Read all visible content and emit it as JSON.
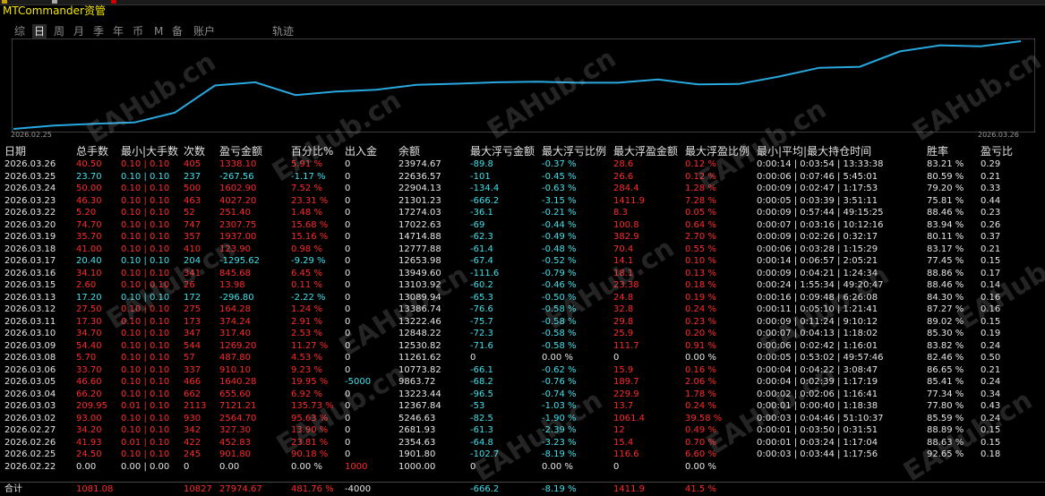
{
  "title": "MTCommander资管",
  "tabs": [
    "综",
    "日",
    "周",
    "月",
    "季",
    "年",
    "币",
    "M",
    "备",
    "账户",
    "轨迹"
  ],
  "active_tab": "日",
  "chart": {
    "start_date": "2026.02.25",
    "end_date": "2026.03.26",
    "line_color": "#29a8e0"
  },
  "headers": [
    "日期",
    "总手数",
    "最小|大手数",
    "次数",
    "盈亏金额",
    "百分比%",
    "出入金",
    "余额",
    "最大浮亏金额",
    "最大浮亏比例",
    "最大浮盈金额",
    "最大浮盈比例",
    "最小|平均|最大持仓时间",
    "胜率",
    "盈亏比"
  ],
  "rows": [
    {
      "d": "2026.03.26",
      "lots": "40.50",
      "mm": "0.10 | 0.10",
      "n": "405",
      "pl": "1338.10",
      "pct": "5.91 %",
      "io": "0",
      "bal": "23974.67",
      "fl": "-89.8",
      "flp": "-0.37 %",
      "fp": "28.6",
      "fpp": "0.12 %",
      "t": "0:00:14 | 0:03:54 | 13:33:38",
      "wr": "83.21 %",
      "rr": "0.29",
      "s": "r"
    },
    {
      "d": "2026.03.25",
      "lots": "23.70",
      "mm": "0.10 | 0.10",
      "n": "237",
      "pl": "-267.56",
      "pct": "-1.17 %",
      "io": "0",
      "bal": "22636.57",
      "fl": "-101",
      "flp": "-0.45 %",
      "fp": "26.6",
      "fpp": "0.12 %",
      "t": "0:00:06 | 0:07:46 | 5:45:01",
      "wr": "80.59 %",
      "rr": "0.21",
      "s": "c"
    },
    {
      "d": "2026.03.24",
      "lots": "50.00",
      "mm": "0.10 | 0.10",
      "n": "500",
      "pl": "1602.90",
      "pct": "7.52 %",
      "io": "0",
      "bal": "22904.13",
      "fl": "-134.4",
      "flp": "-0.63 %",
      "fp": "284.4",
      "fpp": "1.28 %",
      "t": "0:00:09 | 0:02:47 | 1:17:53",
      "wr": "79.20 %",
      "rr": "0.33",
      "s": "r"
    },
    {
      "d": "2026.03.23",
      "lots": "46.30",
      "mm": "0.10 | 0.10",
      "n": "463",
      "pl": "4027.20",
      "pct": "23.31 %",
      "io": "0",
      "bal": "21301.23",
      "fl": "-666.2",
      "flp": "-3.15 %",
      "fp": "1411.9",
      "fpp": "7.28 %",
      "t": "0:00:05 | 0:03:39 | 3:51:11",
      "wr": "75.81 %",
      "rr": "0.44",
      "s": "r"
    },
    {
      "d": "2026.03.22",
      "lots": "5.20",
      "mm": "0.10 | 0.10",
      "n": "52",
      "pl": "251.40",
      "pct": "1.48 %",
      "io": "0",
      "bal": "17274.03",
      "fl": "-36.1",
      "flp": "-0.21 %",
      "fp": "8.3",
      "fpp": "0.05 %",
      "t": "0:00:09 | 0:57:44 | 49:15:25",
      "wr": "88.46 %",
      "rr": "0.23",
      "s": "r"
    },
    {
      "d": "2026.03.20",
      "lots": "74.70",
      "mm": "0.10 | 0.10",
      "n": "747",
      "pl": "2307.75",
      "pct": "15.68 %",
      "io": "0",
      "bal": "17022.63",
      "fl": "-69",
      "flp": "-0.44 %",
      "fp": "100.8",
      "fpp": "0.64 %",
      "t": "0:00:07 | 0:03:16 | 10:12:16",
      "wr": "83.94 %",
      "rr": "0.26",
      "s": "r"
    },
    {
      "d": "2026.03.19",
      "lots": "35.70",
      "mm": "0.10 | 0.10",
      "n": "357",
      "pl": "1937.00",
      "pct": "15.16 %",
      "io": "0",
      "bal": "14714.88",
      "fl": "-62.3",
      "flp": "-0.49 %",
      "fp": "382.9",
      "fpp": "2.70 %",
      "t": "0:00:09 | 0:02:26 | 0:32:17",
      "wr": "80.11 %",
      "rr": "0.37",
      "s": "r"
    },
    {
      "d": "2026.03.18",
      "lots": "41.00",
      "mm": "0.10 | 0.10",
      "n": "410",
      "pl": "123.90",
      "pct": "0.98 %",
      "io": "0",
      "bal": "12777.88",
      "fl": "-61.4",
      "flp": "-0.48 %",
      "fp": "70.4",
      "fpp": "0.55 %",
      "t": "0:00:06 | 0:03:28 | 1:15:29",
      "wr": "83.17 %",
      "rr": "0.21",
      "s": "r"
    },
    {
      "d": "2026.03.17",
      "lots": "20.40",
      "mm": "0.10 | 0.10",
      "n": "204",
      "pl": "-1295.62",
      "pct": "-9.29 %",
      "io": "0",
      "bal": "12653.98",
      "fl": "-67.4",
      "flp": "-0.52 %",
      "fp": "14.1",
      "fpp": "0.10 %",
      "t": "0:00:14 | 0:06:57 | 2:05:21",
      "wr": "77.45 %",
      "rr": "0.15",
      "s": "c"
    },
    {
      "d": "2026.03.16",
      "lots": "34.10",
      "mm": "0.10 | 0.10",
      "n": "341",
      "pl": "845.68",
      "pct": "6.45 %",
      "io": "0",
      "bal": "13949.60",
      "fl": "-111.6",
      "flp": "-0.79 %",
      "fp": "18.1",
      "fpp": "0.13 %",
      "t": "0:00:09 | 0:04:21 | 1:24:34",
      "wr": "88.86 %",
      "rr": "0.17",
      "s": "r"
    },
    {
      "d": "2026.03.15",
      "lots": "2.60",
      "mm": "0.10 | 0.10",
      "n": "26",
      "pl": "13.98",
      "pct": "0.11 %",
      "io": "0",
      "bal": "13103.92",
      "fl": "-60.2",
      "flp": "-0.46 %",
      "fp": "23.38",
      "fpp": "0.18 %",
      "t": "0:00:24 | 1:55:34 | 49:20:47",
      "wr": "88.46 %",
      "rr": "0.14",
      "s": "r"
    },
    {
      "d": "2026.03.13",
      "lots": "17.20",
      "mm": "0.10 | 0.10",
      "n": "172",
      "pl": "-296.80",
      "pct": "-2.22 %",
      "io": "0",
      "bal": "13089.94",
      "fl": "-65.3",
      "flp": "-0.50 %",
      "fp": "24.8",
      "fpp": "0.19 %",
      "t": "0:00:16 | 0:09:48 | 6:26:08",
      "wr": "84.30 %",
      "rr": "0.16",
      "s": "c"
    },
    {
      "d": "2026.03.12",
      "lots": "27.50",
      "mm": "0.10 | 0.10",
      "n": "275",
      "pl": "164.28",
      "pct": "1.24 %",
      "io": "0",
      "bal": "13386.74",
      "fl": "-76.6",
      "flp": "-0.58 %",
      "fp": "32.8",
      "fpp": "0.24 %",
      "t": "0:00:11 | 0:05:10 | 1:21:41",
      "wr": "87.27 %",
      "rr": "0.16",
      "s": "r"
    },
    {
      "d": "2026.03.11",
      "lots": "17.30",
      "mm": "0.10 | 0.10",
      "n": "173",
      "pl": "374.24",
      "pct": "2.91 %",
      "io": "0",
      "bal": "13222.46",
      "fl": "-75.7",
      "flp": "-0.58 %",
      "fp": "29.8",
      "fpp": "0.23 %",
      "t": "0:00:09 | 0:11:24 | 9:10:12",
      "wr": "89.02 %",
      "rr": "0.15",
      "s": "r"
    },
    {
      "d": "2026.03.10",
      "lots": "34.70",
      "mm": "0.10 | 0.10",
      "n": "347",
      "pl": "317.40",
      "pct": "2.53 %",
      "io": "0",
      "bal": "12848.22",
      "fl": "-72.3",
      "flp": "-0.58 %",
      "fp": "25.9",
      "fpp": "0.20 %",
      "t": "0:00:07 | 0:04:13 | 1:18:02",
      "wr": "85.30 %",
      "rr": "0.19",
      "s": "r"
    },
    {
      "d": "2026.03.09",
      "lots": "54.40",
      "mm": "0.10 | 0.10",
      "n": "544",
      "pl": "1269.20",
      "pct": "11.27 %",
      "io": "0",
      "bal": "12530.82",
      "fl": "-71.6",
      "flp": "-0.58 %",
      "fp": "111.7",
      "fpp": "0.91 %",
      "t": "0:00:06 | 0:02:42 | 1:16:01",
      "wr": "83.82 %",
      "rr": "0.24",
      "s": "r"
    },
    {
      "d": "2026.03.08",
      "lots": "5.70",
      "mm": "0.10 | 0.10",
      "n": "57",
      "pl": "487.80",
      "pct": "4.53 %",
      "io": "0",
      "bal": "11261.62",
      "fl": "0",
      "flp": "0.00 %",
      "fp": "0",
      "fpp": "0.00 %",
      "t": "0:00:05 | 0:53:02 | 49:57:46",
      "wr": "82.46 %",
      "rr": "0.50",
      "s": "r",
      "zero": true
    },
    {
      "d": "2026.03.06",
      "lots": "33.70",
      "mm": "0.10 | 0.10",
      "n": "337",
      "pl": "910.10",
      "pct": "9.23 %",
      "io": "0",
      "bal": "10773.82",
      "fl": "-66.1",
      "flp": "-0.62 %",
      "fp": "15.9",
      "fpp": "0.16 %",
      "t": "0:00:04 | 0:04:22 | 3:08:47",
      "wr": "86.65 %",
      "rr": "0.21",
      "s": "r"
    },
    {
      "d": "2026.03.05",
      "lots": "46.60",
      "mm": "0.10 | 0.10",
      "n": "466",
      "pl": "1640.28",
      "pct": "19.95 %",
      "io": "-5000",
      "bal": "9863.72",
      "fl": "-68.2",
      "flp": "-0.76 %",
      "fp": "189.7",
      "fpp": "2.06 %",
      "t": "0:00:04 | 0:02:39 | 1:17:19",
      "wr": "85.41 %",
      "rr": "0.24",
      "s": "r",
      "io_c": true
    },
    {
      "d": "2026.03.04",
      "lots": "66.20",
      "mm": "0.10 | 0.10",
      "n": "662",
      "pl": "655.60",
      "pct": "6.92 %",
      "io": "0",
      "bal": "13223.44",
      "fl": "-96.5",
      "flp": "-0.74 %",
      "fp": "229.9",
      "fpp": "1.78 %",
      "t": "0:00:02 | 0:02:06 | 1:16:41",
      "wr": "77.34 %",
      "rr": "0.34",
      "s": "r"
    },
    {
      "d": "2026.03.03",
      "lots": "209.95",
      "mm": "0.01 | 0.10",
      "n": "2113",
      "pl": "7121.21",
      "pct": "135.73 %",
      "io": "0",
      "bal": "12367.84",
      "fl": "-53",
      "flp": "-1.03 %",
      "fp": "13.7",
      "fpp": "0.24 %",
      "t": "0:00:01 | 0:00:40 | 1:18:38",
      "wr": "77.80 %",
      "rr": "0.43",
      "s": "r"
    },
    {
      "d": "2026.03.02",
      "lots": "93.00",
      "mm": "0.10 | 0.10",
      "n": "930",
      "pl": "2564.70",
      "pct": "95.63 %",
      "io": "0",
      "bal": "5246.63",
      "fl": "-82.5",
      "flp": "-1.90 %",
      "fp": "1061.4",
      "fpp": "39.58 %",
      "t": "0:00:03 | 0:04:46 | 51:10:37",
      "wr": "85.59 %",
      "rr": "0.24",
      "s": "r"
    },
    {
      "d": "2026.02.27",
      "lots": "34.20",
      "mm": "0.10 | 0.10",
      "n": "342",
      "pl": "327.30",
      "pct": "13.90 %",
      "io": "0",
      "bal": "2681.93",
      "fl": "-61.3",
      "flp": "-2.39 %",
      "fp": "12",
      "fpp": "0.49 %",
      "t": "0:00:01 | 0:03:50 | 0:31:51",
      "wr": "88.89 %",
      "rr": "0.15",
      "s": "r"
    },
    {
      "d": "2026.02.26",
      "lots": "41.93",
      "mm": "0.01 | 0.10",
      "n": "422",
      "pl": "452.83",
      "pct": "23.81 %",
      "io": "0",
      "bal": "2354.63",
      "fl": "-64.8",
      "flp": "-3.23 %",
      "fp": "15.4",
      "fpp": "0.70 %",
      "t": "0:00:01 | 0:03:24 | 1:17:04",
      "wr": "88.63 %",
      "rr": "0.15",
      "s": "r"
    },
    {
      "d": "2026.02.25",
      "lots": "24.50",
      "mm": "0.10 | 0.10",
      "n": "245",
      "pl": "901.80",
      "pct": "90.18 %",
      "io": "0",
      "bal": "1901.80",
      "fl": "-102.7",
      "flp": "-8.19 %",
      "fp": "116.6",
      "fpp": "6.60 %",
      "t": "0:00:03 | 0:03:44 | 1:17:56",
      "wr": "92.65 %",
      "rr": "0.18",
      "s": "r"
    },
    {
      "d": "2026.02.22",
      "lots": "0.00",
      "mm": "0.00 | 0.00",
      "n": "0",
      "pl": "0.00",
      "pct": "0.00 %",
      "io": "1000",
      "bal": "1000.00",
      "fl": "0",
      "flp": "0.00 %",
      "fp": "0",
      "fpp": "0.00 %",
      "t": "",
      "wr": "",
      "rr": "",
      "s": "w",
      "io_r": true
    }
  ],
  "totals": {
    "label": "合计",
    "lots": "1081.08",
    "n": "10827",
    "pl": "27974.67",
    "pct": "481.76 %",
    "io": "-4000",
    "fl": "-666.2",
    "flp": "-8.19 %",
    "fp": "1411.9",
    "fpp": "41.5 %"
  },
  "watermark": "EAHub.cn"
}
